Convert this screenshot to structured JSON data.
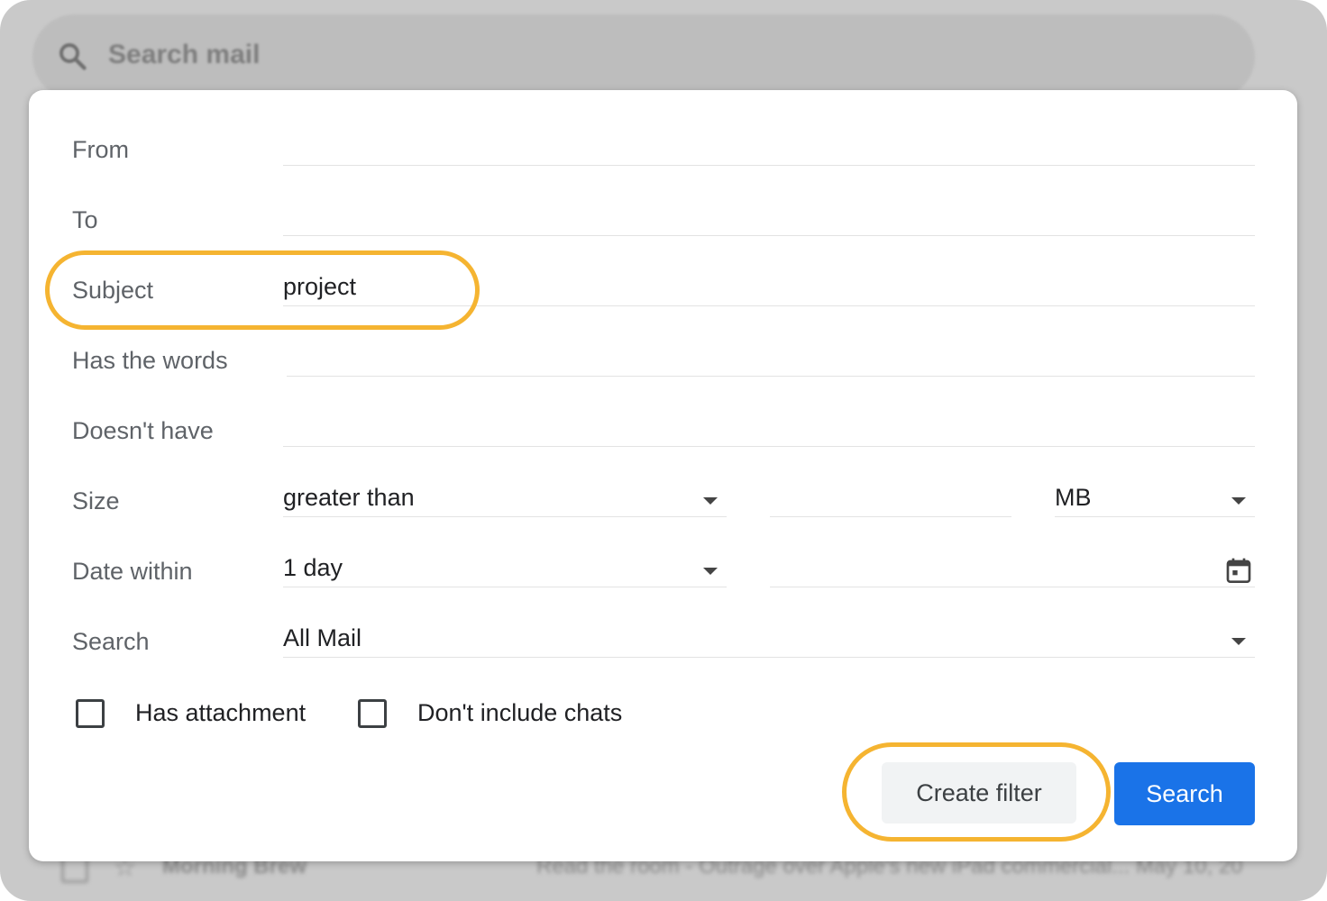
{
  "background": {
    "search_placeholder": "Search mail",
    "email_row": {
      "sender": "Morning Brew",
      "subject": "Read the room - Outrage over Apple's new iPad commercial... May 10, 20"
    }
  },
  "dialog": {
    "fields": {
      "from": {
        "label": "From",
        "value": ""
      },
      "to": {
        "label": "To",
        "value": ""
      },
      "subject": {
        "label": "Subject",
        "value": "project"
      },
      "has_words": {
        "label": "Has the words",
        "value": ""
      },
      "doesnt_have": {
        "label": "Doesn't have",
        "value": ""
      },
      "size": {
        "label": "Size",
        "operator": "greater than",
        "amount": "",
        "unit": "MB"
      },
      "date_within": {
        "label": "Date within",
        "value": "1 day",
        "date": ""
      },
      "search": {
        "label": "Search",
        "value": "All Mail"
      }
    },
    "checkboxes": {
      "has_attachment": {
        "label": "Has attachment",
        "checked": false
      },
      "dont_include_chats": {
        "label": "Don't include chats",
        "checked": false
      }
    },
    "buttons": {
      "create_filter": "Create filter",
      "search": "Search"
    }
  },
  "colors": {
    "highlight": "#f5b431",
    "primary_button": "#1a73e8",
    "label_text": "#5f6368"
  },
  "icons": [
    "search-icon",
    "dropdown-caret-icon",
    "calendar-icon",
    "star-icon"
  ]
}
